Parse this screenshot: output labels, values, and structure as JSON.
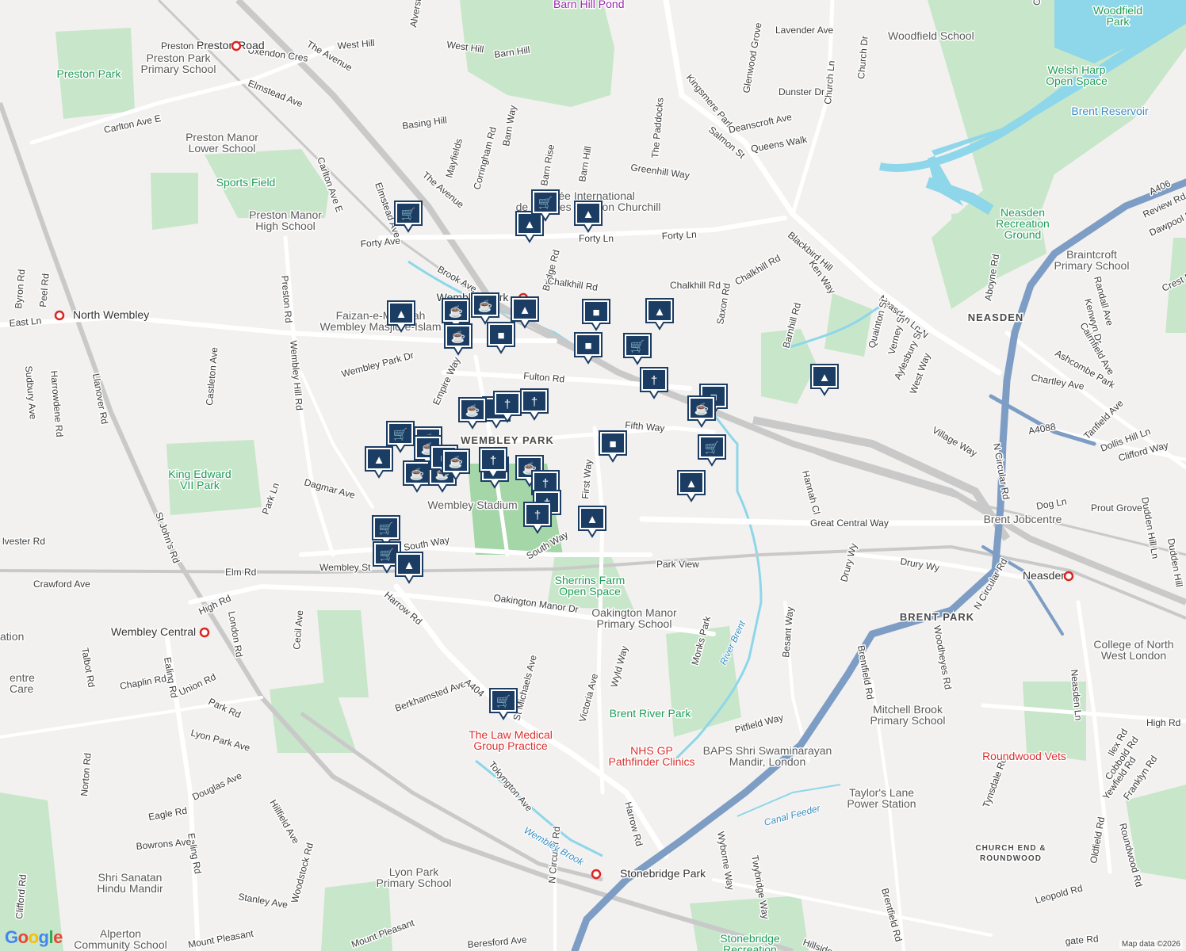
{
  "colors": {
    "background": "#f2f1ef",
    "park": "#c8e6c9",
    "park_dark": "#b5dfb8",
    "water": "#8ed6ea",
    "major_road": "#7d9dc5",
    "road": "#ffffff",
    "rail": "#c9c9c9",
    "pin": "#1c3d63",
    "poi_school": "#7c7c7c",
    "poi_health": "#e03c3c",
    "poi_park": "#1f9c57",
    "poi_photo": "#9c27b0"
  },
  "roads": [
    {
      "id": "preston-road",
      "label": "Preston Road"
    },
    {
      "id": "uxendon-cres",
      "label": "Uxendon Cres"
    },
    {
      "id": "the-avenue-n",
      "label": "The Avenue"
    },
    {
      "id": "west-hill-1",
      "label": "West Hill"
    },
    {
      "id": "west-hill-2",
      "label": "West Hill"
    },
    {
      "id": "barn-hill",
      "label": "Barn Hill"
    },
    {
      "id": "alverstone",
      "label": "Alverstone"
    },
    {
      "id": "elmstead-ave",
      "label": "Elmstead Ave"
    },
    {
      "id": "carlton-ave-e",
      "label": "Carlton Ave E"
    },
    {
      "id": "basing-hill",
      "label": "Basing Hill"
    },
    {
      "id": "the-avenue-s",
      "label": "The Avenue"
    },
    {
      "id": "mayfields",
      "label": "Mayfields"
    },
    {
      "id": "corringham-rd",
      "label": "Corringham Rd"
    },
    {
      "id": "barn-way",
      "label": "Barn Way"
    },
    {
      "id": "barn-rise",
      "label": "Barn Rise"
    },
    {
      "id": "barn-hill-2",
      "label": "Barn Hill"
    },
    {
      "id": "lavender-ave",
      "label": "Lavender Ave"
    },
    {
      "id": "glenwood-grove",
      "label": "Glenwood Grove"
    },
    {
      "id": "kingsmere-park",
      "label": "Kingsmere Park"
    },
    {
      "id": "dunster-dr",
      "label": "Dunster Dr"
    },
    {
      "id": "church-ln",
      "label": "Church Ln"
    },
    {
      "id": "church-dr",
      "label": "Church Dr"
    },
    {
      "id": "the-paddocks",
      "label": "The Paddocks"
    },
    {
      "id": "deanscroft-ave",
      "label": "Deanscroft Ave"
    },
    {
      "id": "salmon-st",
      "label": "Salmon St"
    },
    {
      "id": "queens-walk",
      "label": "Queens Walk"
    },
    {
      "id": "greenhill-way",
      "label": "Greenhill Way"
    },
    {
      "id": "carlton-ave-e2",
      "label": "Carlton Ave E"
    },
    {
      "id": "elmstead-ave2",
      "label": "Elmstead Ave"
    },
    {
      "id": "forty-ave",
      "label": "Forty Ave"
    },
    {
      "id": "forty-ln-1",
      "label": "Forty Ln"
    },
    {
      "id": "forty-ln-2",
      "label": "Forty Ln"
    },
    {
      "id": "blackbird-hill",
      "label": "Blackbird Hill"
    },
    {
      "id": "ken-way",
      "label": "Ken Way"
    },
    {
      "id": "bridge-rd",
      "label": "Bridge Rd"
    },
    {
      "id": "brook-ave",
      "label": "Brook Ave"
    },
    {
      "id": "chalkhill-rd-1",
      "label": "Chalkhill Rd"
    },
    {
      "id": "chalkhill-rd-2",
      "label": "Chalkhill Rd"
    },
    {
      "id": "chalkhill-rd-3",
      "label": "Chalkhill Rd"
    },
    {
      "id": "saxon-rd",
      "label": "Saxon Rd"
    },
    {
      "id": "barnhill-rd",
      "label": "Barnhill Rd"
    },
    {
      "id": "neasden-ln-n",
      "label": "Neasden Ln N"
    },
    {
      "id": "byron-rd",
      "label": "Byron Rd"
    },
    {
      "id": "peel-rd",
      "label": "Peel Rd"
    },
    {
      "id": "east-ln",
      "label": "East Ln"
    },
    {
      "id": "preston-rd",
      "label": "Preston Rd"
    },
    {
      "id": "sudbury-ave",
      "label": "Sudbury Ave"
    },
    {
      "id": "harrowdene-rd",
      "label": "Harrowdene Rd"
    },
    {
      "id": "llanover-rd",
      "label": "Llanover Rd"
    },
    {
      "id": "castleton-ave",
      "label": "Castleton Ave"
    },
    {
      "id": "wembley-hill-rd",
      "label": "Wembley Hill Rd"
    },
    {
      "id": "wembley-park-dr",
      "label": "Wembley Park Dr"
    },
    {
      "id": "empire-way",
      "label": "Empire Way"
    },
    {
      "id": "fulton-rd",
      "label": "Fulton Rd"
    },
    {
      "id": "fifth-way",
      "label": "Fifth Way"
    },
    {
      "id": "first-way",
      "label": "First Way"
    },
    {
      "id": "quainton-st",
      "label": "Quainton St"
    },
    {
      "id": "verney-st",
      "label": "Verney St"
    },
    {
      "id": "aylesbury-st",
      "label": "Aylesbury St"
    },
    {
      "id": "west-way",
      "label": "West Way"
    },
    {
      "id": "village-way",
      "label": "Village Way"
    },
    {
      "id": "aboyne-rd",
      "label": "Aboyne Rd"
    },
    {
      "id": "randall-ave",
      "label": "Randall Ave"
    },
    {
      "id": "kenwyn-dr",
      "label": "Kenwyn Dr"
    },
    {
      "id": "cairnfield-ave",
      "label": "Cairnfield Ave"
    },
    {
      "id": "ashcombe-park",
      "label": "Ashcombe Park"
    },
    {
      "id": "chartley-ave",
      "label": "Chartley Ave"
    },
    {
      "id": "tanfield-ave",
      "label": "Tanfield Ave"
    },
    {
      "id": "dollis-hill-ln",
      "label": "Dollis Hill Ln"
    },
    {
      "id": "clifford-way",
      "label": "Clifford Way"
    },
    {
      "id": "a4088",
      "label": "A4088"
    },
    {
      "id": "a406",
      "label": "A406"
    },
    {
      "id": "review-rd",
      "label": "Review Rd"
    },
    {
      "id": "dawpool-rd",
      "label": "Dawpool Rd"
    },
    {
      "id": "crest-rd",
      "label": "Crest R"
    },
    {
      "id": "n-circular-rd-1",
      "label": "N Circular Rd"
    },
    {
      "id": "dog-ln",
      "label": "Dog Ln"
    },
    {
      "id": "prout-grove",
      "label": "Prout Grove"
    },
    {
      "id": "dudden-hill-ln-1",
      "label": "Dudden Hill Ln"
    },
    {
      "id": "dudden-hill-ln-2",
      "label": "Dudden Hill"
    },
    {
      "id": "hannah-cl",
      "label": "Hannah Cl"
    },
    {
      "id": "great-central-way",
      "label": "Great Central Way"
    },
    {
      "id": "drury-wy-1",
      "label": "Drury Wy"
    },
    {
      "id": "drury-wy-2",
      "label": "Drury Wy"
    },
    {
      "id": "n-circular-rd-2",
      "label": "N Circular Rd"
    },
    {
      "id": "dagmar-ave",
      "label": "Dagmar Ave"
    },
    {
      "id": "park-ln",
      "label": "Park Ln"
    },
    {
      "id": "st-johns-rd",
      "label": "St John's Rd"
    },
    {
      "id": "sylvester-rd",
      "label": "lvester Rd"
    },
    {
      "id": "south-way-1",
      "label": "South Way"
    },
    {
      "id": "south-way-2",
      "label": "South Way"
    },
    {
      "id": "park-view",
      "label": "Park View"
    },
    {
      "id": "elm-rd",
      "label": "Elm Rd"
    },
    {
      "id": "wembley-st",
      "label": "Wembley St"
    },
    {
      "id": "crawford-ave",
      "label": "Crawford Ave"
    },
    {
      "id": "high-rd",
      "label": "High Rd"
    },
    {
      "id": "harrow-rd-1",
      "label": "Harrow Rd"
    },
    {
      "id": "oakington-manor-dr",
      "label": "Oakington Manor Dr"
    },
    {
      "id": "cecil-ave",
      "label": "Cecil Ave"
    },
    {
      "id": "london-rd",
      "label": "London Rd"
    },
    {
      "id": "monks-park",
      "label": "Monks Park"
    },
    {
      "id": "besant-way",
      "label": "Besant Way"
    },
    {
      "id": "brentfield-rd-1",
      "label": "Brentfield Rd"
    },
    {
      "id": "woodheyes-rd",
      "label": "Woodheyes Rd"
    },
    {
      "id": "neasden-ln",
      "label": "Neasden Ln"
    },
    {
      "id": "talbot-rd",
      "label": "Talbot Rd"
    },
    {
      "id": "ealing-rd-1",
      "label": "Ealing Rd"
    },
    {
      "id": "chaplin-rd",
      "label": "Chaplin Rd"
    },
    {
      "id": "union-rd",
      "label": "Union Rd"
    },
    {
      "id": "park-rd",
      "label": "Park Rd"
    },
    {
      "id": "berkhamsted-ave",
      "label": "Berkhamsted Ave"
    },
    {
      "id": "a404",
      "label": "A404"
    },
    {
      "id": "st-michaels-ave",
      "label": "St Michaels Ave"
    },
    {
      "id": "victoria-ave",
      "label": "Victoria Ave"
    },
    {
      "id": "wyld-way",
      "label": "Wyld Way"
    },
    {
      "id": "pitfield-way",
      "label": "Pitfield Way"
    },
    {
      "id": "high-rd-2",
      "label": "High Rd"
    },
    {
      "id": "ilex-rd",
      "label": "Ilex Rd"
    },
    {
      "id": "cobbold-rd",
      "label": "Cobbold Rd"
    },
    {
      "id": "yewfield-rd",
      "label": "Yewfield Rd"
    },
    {
      "id": "franklyn-rd",
      "label": "Franklyn Rd"
    },
    {
      "id": "tynsdale-rd",
      "label": "Tynsdale Rd"
    },
    {
      "id": "oldfield-rd",
      "label": "Oldfield Rd"
    },
    {
      "id": "roundwood-rd",
      "label": "Roundwood Rd"
    },
    {
      "id": "lyon-park-ave",
      "label": "Lyon Park Ave"
    },
    {
      "id": "norton-rd",
      "label": "Norton Rd"
    },
    {
      "id": "douglas-ave",
      "label": "Douglas Ave"
    },
    {
      "id": "eagle-rd",
      "label": "Eagle Rd"
    },
    {
      "id": "ealing-rd-2",
      "label": "Ealing Rd"
    },
    {
      "id": "hillfield-ave",
      "label": "Hillfield Ave"
    },
    {
      "id": "tokyngton-ave",
      "label": "Tokyngton Ave"
    },
    {
      "id": "harrow-rd-2",
      "label": "Harrow Rd"
    },
    {
      "id": "bowrons-ave",
      "label": "Bowrons Ave"
    },
    {
      "id": "wyborne-way",
      "label": "Wyborne Way"
    },
    {
      "id": "twybridge-way",
      "label": "Twybridge Way"
    },
    {
      "id": "brentfield-rd-2",
      "label": "Brentfield Rd"
    },
    {
      "id": "leopold-rd",
      "label": "Leopold Rd"
    },
    {
      "id": "clifford-rd",
      "label": "Clifford Rd"
    },
    {
      "id": "woodstock-rd",
      "label": "Woodstock Rd"
    },
    {
      "id": "stanley-ave",
      "label": "Stanley Ave"
    },
    {
      "id": "n-circular-rd-3",
      "label": "N Circular Rd"
    },
    {
      "id": "mount-pleasant-1",
      "label": "Mount Pleasant"
    },
    {
      "id": "mount-pleasant-2",
      "label": "Mount Pleasant"
    },
    {
      "id": "beresford-ave",
      "label": "Beresford Ave"
    },
    {
      "id": "hillside",
      "label": "Hillside"
    },
    {
      "id": "gate-rd",
      "label": "gate Rd"
    },
    {
      "id": "cobb-rd",
      "label": "Cob"
    }
  ],
  "places": [
    {
      "id": "barn-hill-pond",
      "label": "Barn Hill Pond",
      "kind": "photo"
    },
    {
      "id": "woodfield-park",
      "label": "Woodfield\nPark",
      "kind": "park"
    },
    {
      "id": "woodfield-school",
      "label": "Woodfield School",
      "kind": "school"
    },
    {
      "id": "preston-park-school",
      "label": "Preston Park\nPrimary School",
      "kind": "school"
    },
    {
      "id": "preston-park",
      "label": "Preston Park",
      "kind": "park"
    },
    {
      "id": "welsh-harp",
      "label": "Welsh Harp\nOpen Space",
      "kind": "park"
    },
    {
      "id": "brent-reservoir",
      "label": "Brent Reservoir",
      "kind": "water"
    },
    {
      "id": "preston-manor-lower",
      "label": "Preston Manor\nLower School",
      "kind": "school"
    },
    {
      "id": "sports-field",
      "label": "Sports Field",
      "kind": "park"
    },
    {
      "id": "preston-manor-high",
      "label": "Preston Manor\nHigh School",
      "kind": "school"
    },
    {
      "id": "lycee",
      "label": "Lycée International\nde Londres Winston Churchill",
      "kind": "school"
    },
    {
      "id": "neasden-rec",
      "label": "Neasden\nRecreation\nGround",
      "kind": "park"
    },
    {
      "id": "braintcroft",
      "label": "Braintcroft\nPrimary School",
      "kind": "school"
    },
    {
      "id": "faizan",
      "label": "Faizan-e-Madinah\nWembley Masjid-e-Islam",
      "kind": "worship"
    },
    {
      "id": "wembley-stadium",
      "label": "Wembley Stadium",
      "kind": "stadium"
    },
    {
      "id": "king-edward",
      "label": "King Edward\nVII Park",
      "kind": "park"
    },
    {
      "id": "brent-jobcentre",
      "label": "Brent Jobcentre",
      "kind": "gov"
    },
    {
      "id": "sherrins-farm",
      "label": "Sherrins Farm\nOpen Space",
      "kind": "park"
    },
    {
      "id": "oakington-manor",
      "label": "Oakington Manor\nPrimary School",
      "kind": "school"
    },
    {
      "id": "college-north-west",
      "label": "College of North\nWest London",
      "kind": "school"
    },
    {
      "id": "mitchell-brook",
      "label": "Mitchell Brook\nPrimary School",
      "kind": "school"
    },
    {
      "id": "brent-river-park",
      "label": "Brent River Park",
      "kind": "park"
    },
    {
      "id": "law-medical",
      "label": "The Law Medical\nGroup Practice",
      "kind": "health"
    },
    {
      "id": "nhs-gp",
      "label": "NHS GP\nPathfinder Clinics",
      "kind": "health"
    },
    {
      "id": "baps",
      "label": "BAPS Shri Swaminarayan\nMandir, London",
      "kind": "worship"
    },
    {
      "id": "roundwood-vets",
      "label": "Roundwood Vets",
      "kind": "vet"
    },
    {
      "id": "taylors-lane",
      "label": "Taylor's Lane\nPower Station",
      "kind": "industry"
    },
    {
      "id": "lyon-park-school",
      "label": "Lyon Park\nPrimary School",
      "kind": "school"
    },
    {
      "id": "shri-sanatan",
      "label": "Shri Sanatan\nHindu Mandir",
      "kind": "worship"
    },
    {
      "id": "alperton-school",
      "label": "Alperton\nCommunity School",
      "kind": "school"
    },
    {
      "id": "stonebridge-rec",
      "label": "Stonebridge\nRecreation",
      "kind": "park"
    },
    {
      "id": "centre-care",
      "label": "entre\nCare",
      "kind": "gov"
    },
    {
      "id": "wembley-central-edge",
      "label": "ation",
      "kind": "school"
    }
  ],
  "areas": [
    {
      "id": "neasden-area",
      "label": "NEASDEN"
    },
    {
      "id": "brent-park-area",
      "label": "BRENT PARK"
    },
    {
      "id": "wembley-park-area",
      "label": "WEMBLEY PARK"
    },
    {
      "id": "church-end-area",
      "label": "CHURCH END &\nROUNDWOOD"
    }
  ],
  "stations": [
    {
      "id": "preston-road-stn",
      "label": "Preston Road"
    },
    {
      "id": "north-wembley-stn",
      "label": "North Wembley"
    },
    {
      "id": "wembley-park-stn",
      "label": "Wembley Park"
    },
    {
      "id": "wembley-stadium-stn",
      "label": "Wembley Stadium"
    },
    {
      "id": "wembley-central-stn",
      "label": "Wembley Central"
    },
    {
      "id": "neasden-stn",
      "label": "Neasden"
    },
    {
      "id": "stonebridge-park-stn",
      "label": "Stonebridge Park"
    }
  ],
  "water_labels": [
    {
      "id": "river-brent",
      "label": "River Brent"
    },
    {
      "id": "wembley-brook",
      "label": "Wembley Brook"
    },
    {
      "id": "canal-feeder",
      "label": "Canal Feeder"
    }
  ],
  "pins": [
    {
      "type": "grocery"
    },
    {
      "type": "school"
    },
    {
      "type": "school"
    },
    {
      "type": "grocery"
    },
    {
      "type": "cafe"
    },
    {
      "type": "shop"
    },
    {
      "type": "cafe"
    },
    {
      "type": "school"
    },
    {
      "type": "cafe"
    },
    {
      "type": "school"
    },
    {
      "type": "shop"
    },
    {
      "type": "shop"
    },
    {
      "type": "grocery"
    },
    {
      "type": "school"
    },
    {
      "type": "restaurant"
    },
    {
      "type": "shop"
    },
    {
      "type": "cafe"
    },
    {
      "type": "school"
    },
    {
      "type": "restaurant"
    },
    {
      "type": "restaurant"
    },
    {
      "type": "cafe"
    },
    {
      "type": "restaurant"
    },
    {
      "type": "grocery"
    },
    {
      "type": "cafe"
    },
    {
      "type": "school"
    },
    {
      "type": "cafe"
    },
    {
      "type": "cafe"
    },
    {
      "type": "cafe"
    },
    {
      "type": "restaurant"
    },
    {
      "type": "restaurant"
    },
    {
      "type": "cafe"
    },
    {
      "type": "restaurant"
    },
    {
      "type": "restaurant"
    },
    {
      "type": "restaurant"
    },
    {
      "type": "shop"
    },
    {
      "type": "school"
    },
    {
      "type": "grocery"
    },
    {
      "type": "shop"
    },
    {
      "type": "cafe"
    },
    {
      "type": "grocery"
    },
    {
      "type": "grocery"
    },
    {
      "type": "school"
    },
    {
      "type": "school"
    },
    {
      "type": "grocery"
    }
  ],
  "attribution": "Map data ©2026",
  "logo": "Google"
}
